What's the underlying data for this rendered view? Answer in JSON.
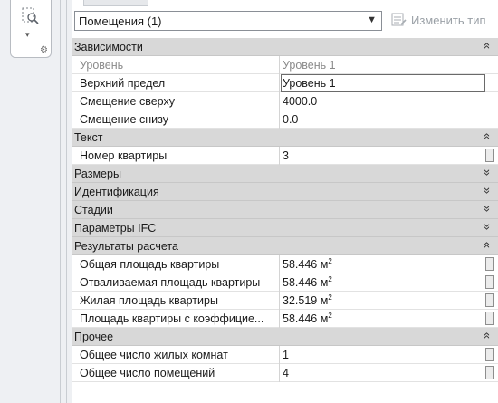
{
  "type_selector": {
    "value": "Помещения (1)",
    "edit_type_label": "Изменить тип"
  },
  "groups": [
    {
      "label": "Зависимости",
      "collapsed": false,
      "properties": [
        {
          "name": "Уровень",
          "value": "Уровень 1",
          "readonly": true
        },
        {
          "name": "Верхний предел",
          "value": "Уровень 1",
          "editing": true
        },
        {
          "name": "Смещение сверху",
          "value": "4000.0"
        },
        {
          "name": "Смещение снизу",
          "value": "0.0"
        }
      ]
    },
    {
      "label": "Текст",
      "collapsed": false,
      "properties": [
        {
          "name": "Номер квартиры",
          "value": "3",
          "stub": true
        }
      ]
    },
    {
      "label": "Размеры",
      "collapsed": true,
      "properties": []
    },
    {
      "label": "Идентификация",
      "collapsed": true,
      "properties": []
    },
    {
      "label": "Стадии",
      "collapsed": true,
      "properties": []
    },
    {
      "label": "Параметры IFC",
      "collapsed": true,
      "properties": []
    },
    {
      "label": "Результаты расчета",
      "collapsed": false,
      "properties": [
        {
          "name": "Общая площадь квартиры",
          "value": "58.446 м",
          "sup": "2",
          "stub": true
        },
        {
          "name": "Отваливаемая площадь квартиры",
          "value": "58.446 м",
          "sup": "2",
          "stub": true
        },
        {
          "name": "Жилая площадь квартиры",
          "value": "32.519 м",
          "sup": "2",
          "stub": true
        },
        {
          "name": "Площадь квартиры с коэффицие...",
          "value": "58.446 м",
          "sup": "2",
          "stub": true
        }
      ]
    },
    {
      "label": "Прочее",
      "collapsed": false,
      "properties": [
        {
          "name": "Общее число жилых комнат",
          "value": "1",
          "stub": true
        },
        {
          "name": "Общее число помещений",
          "value": "4",
          "stub": true
        }
      ]
    }
  ],
  "icons": {
    "tool": "select-filter-icon",
    "dropdown": "chevron-down-icon",
    "edit_type": "edit-type-icon",
    "collapse": "double-chevron-up-icon",
    "expand": "double-chevron-down-icon"
  }
}
